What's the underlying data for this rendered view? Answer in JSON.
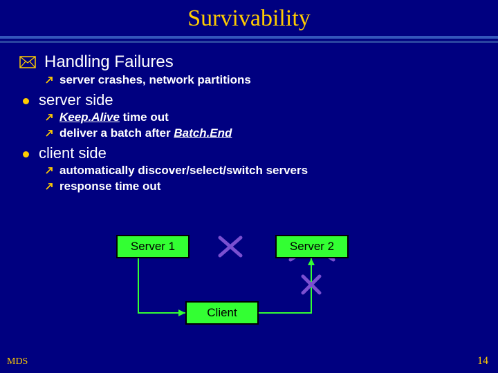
{
  "title": "Survivability",
  "bullets": {
    "l1": "Handling Failures",
    "l1_sub1": "server crashes, network partitions",
    "l2a": "server side",
    "l2a_sub1_pre": "",
    "l2a_sub1_ul": "Keep.Alive",
    "l2a_sub1_post": " time out",
    "l2a_sub2_pre": "deliver a batch after ",
    "l2a_sub2_ul": "Batch.End",
    "l2b": "client side",
    "l2b_sub1": "automatically discover/select/switch servers",
    "l2b_sub2": "response time out"
  },
  "diagram": {
    "server1": "Server 1",
    "server2": "Server 2",
    "client": "Client"
  },
  "footer": {
    "left": "MDS",
    "right": "14"
  },
  "colors": {
    "bg": "#000080",
    "accent": "#ffcc00",
    "boxfill": "#33ff33",
    "cross": "#7a4fd0"
  }
}
